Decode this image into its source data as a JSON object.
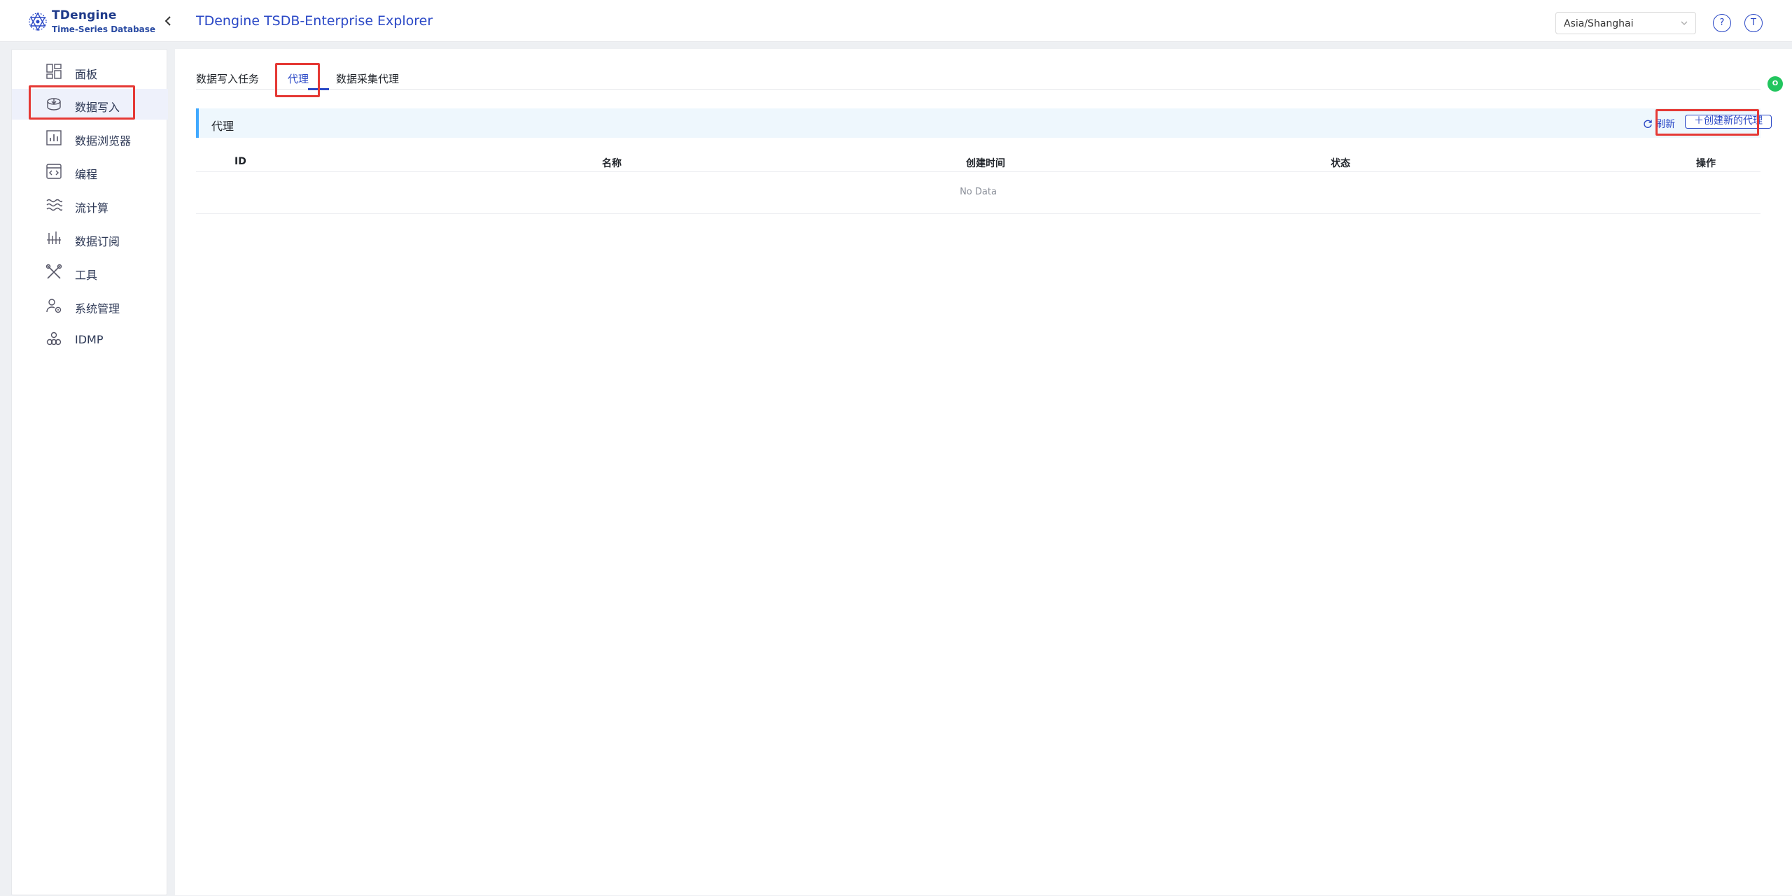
{
  "header": {
    "logo_name": "TDengine",
    "logo_sub": "Time-Series Database",
    "app_title": "TDengine TSDB-Enterprise Explorer",
    "timezone": "Asia/Shanghai",
    "help_label": "?",
    "user_initial": "T"
  },
  "sidebar": {
    "items": [
      {
        "label": "面板",
        "icon": "dashboard-icon"
      },
      {
        "label": "数据写入",
        "icon": "database-icon"
      },
      {
        "label": "数据浏览器",
        "icon": "chart-icon"
      },
      {
        "label": "编程",
        "icon": "code-icon"
      },
      {
        "label": "流计算",
        "icon": "stream-icon"
      },
      {
        "label": "数据订阅",
        "icon": "subscribe-icon"
      },
      {
        "label": "工具",
        "icon": "tools-icon"
      },
      {
        "label": "系统管理",
        "icon": "user-gear-icon"
      },
      {
        "label": "IDMP",
        "icon": "cluster-icon"
      }
    ],
    "active_index": 1
  },
  "main": {
    "tabs": [
      {
        "label": "数据写入任务"
      },
      {
        "label": "代理"
      },
      {
        "label": "数据采集代理"
      }
    ],
    "active_tab": 1,
    "panel": {
      "title": "代理",
      "refresh_label": "刷新",
      "create_label": "创建新的代理"
    },
    "table": {
      "columns": [
        "ID",
        "名称",
        "创建时间",
        "状态",
        "操作"
      ],
      "empty_text": "No Data"
    }
  },
  "colors": {
    "accent": "#2a48c6",
    "highlight": "#e53935",
    "panel_bg": "#eef7fd",
    "panel_border": "#40a9ff"
  },
  "float_badge": "O"
}
